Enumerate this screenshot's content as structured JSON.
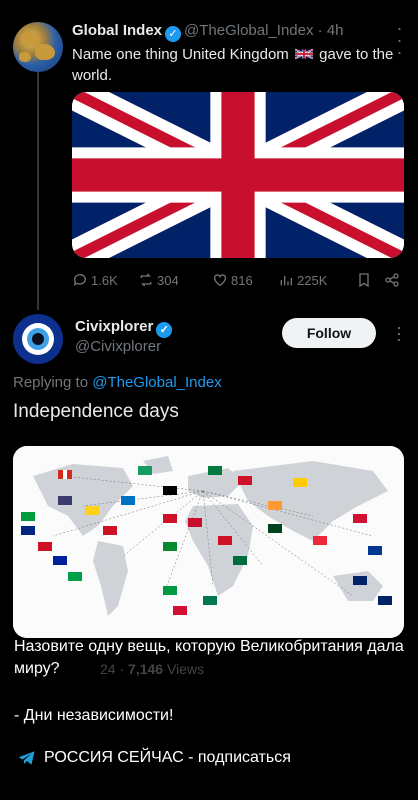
{
  "post1": {
    "name": "Global Index",
    "handle": "@TheGlobal_Index",
    "time": "4h",
    "text_before": "Name one thing United Kingdom",
    "text_after": "gave to the world.",
    "stats": {
      "replies": "1.6K",
      "reposts": "304",
      "likes": "816",
      "views": "225K"
    }
  },
  "post2": {
    "name": "Civixplorer",
    "handle": "@Civixplorer",
    "follow_label": "Follow",
    "replying_prefix": "Replying to",
    "replying_to": "@TheGlobal_Index",
    "text": "Independence days",
    "timestamp": "24",
    "views_count": "7,146",
    "views_label": "Views"
  },
  "overlay": {
    "line1": "Назовите одну вещь, которую Великобритания дала миру?",
    "line2": "- Дни независимости!",
    "channel": "РОССИЯ СЕЙЧАС - подписаться"
  },
  "icons": {
    "verified": "verified-badge-icon",
    "reply": "reply-icon",
    "repost": "repost-icon",
    "like": "heart-icon",
    "views": "views-icon",
    "bookmark": "bookmark-icon",
    "share": "share-icon",
    "telegram": "telegram-icon"
  },
  "colors": {
    "accent": "#1d9bf0",
    "muted": "#71767b",
    "background": "#000000"
  }
}
